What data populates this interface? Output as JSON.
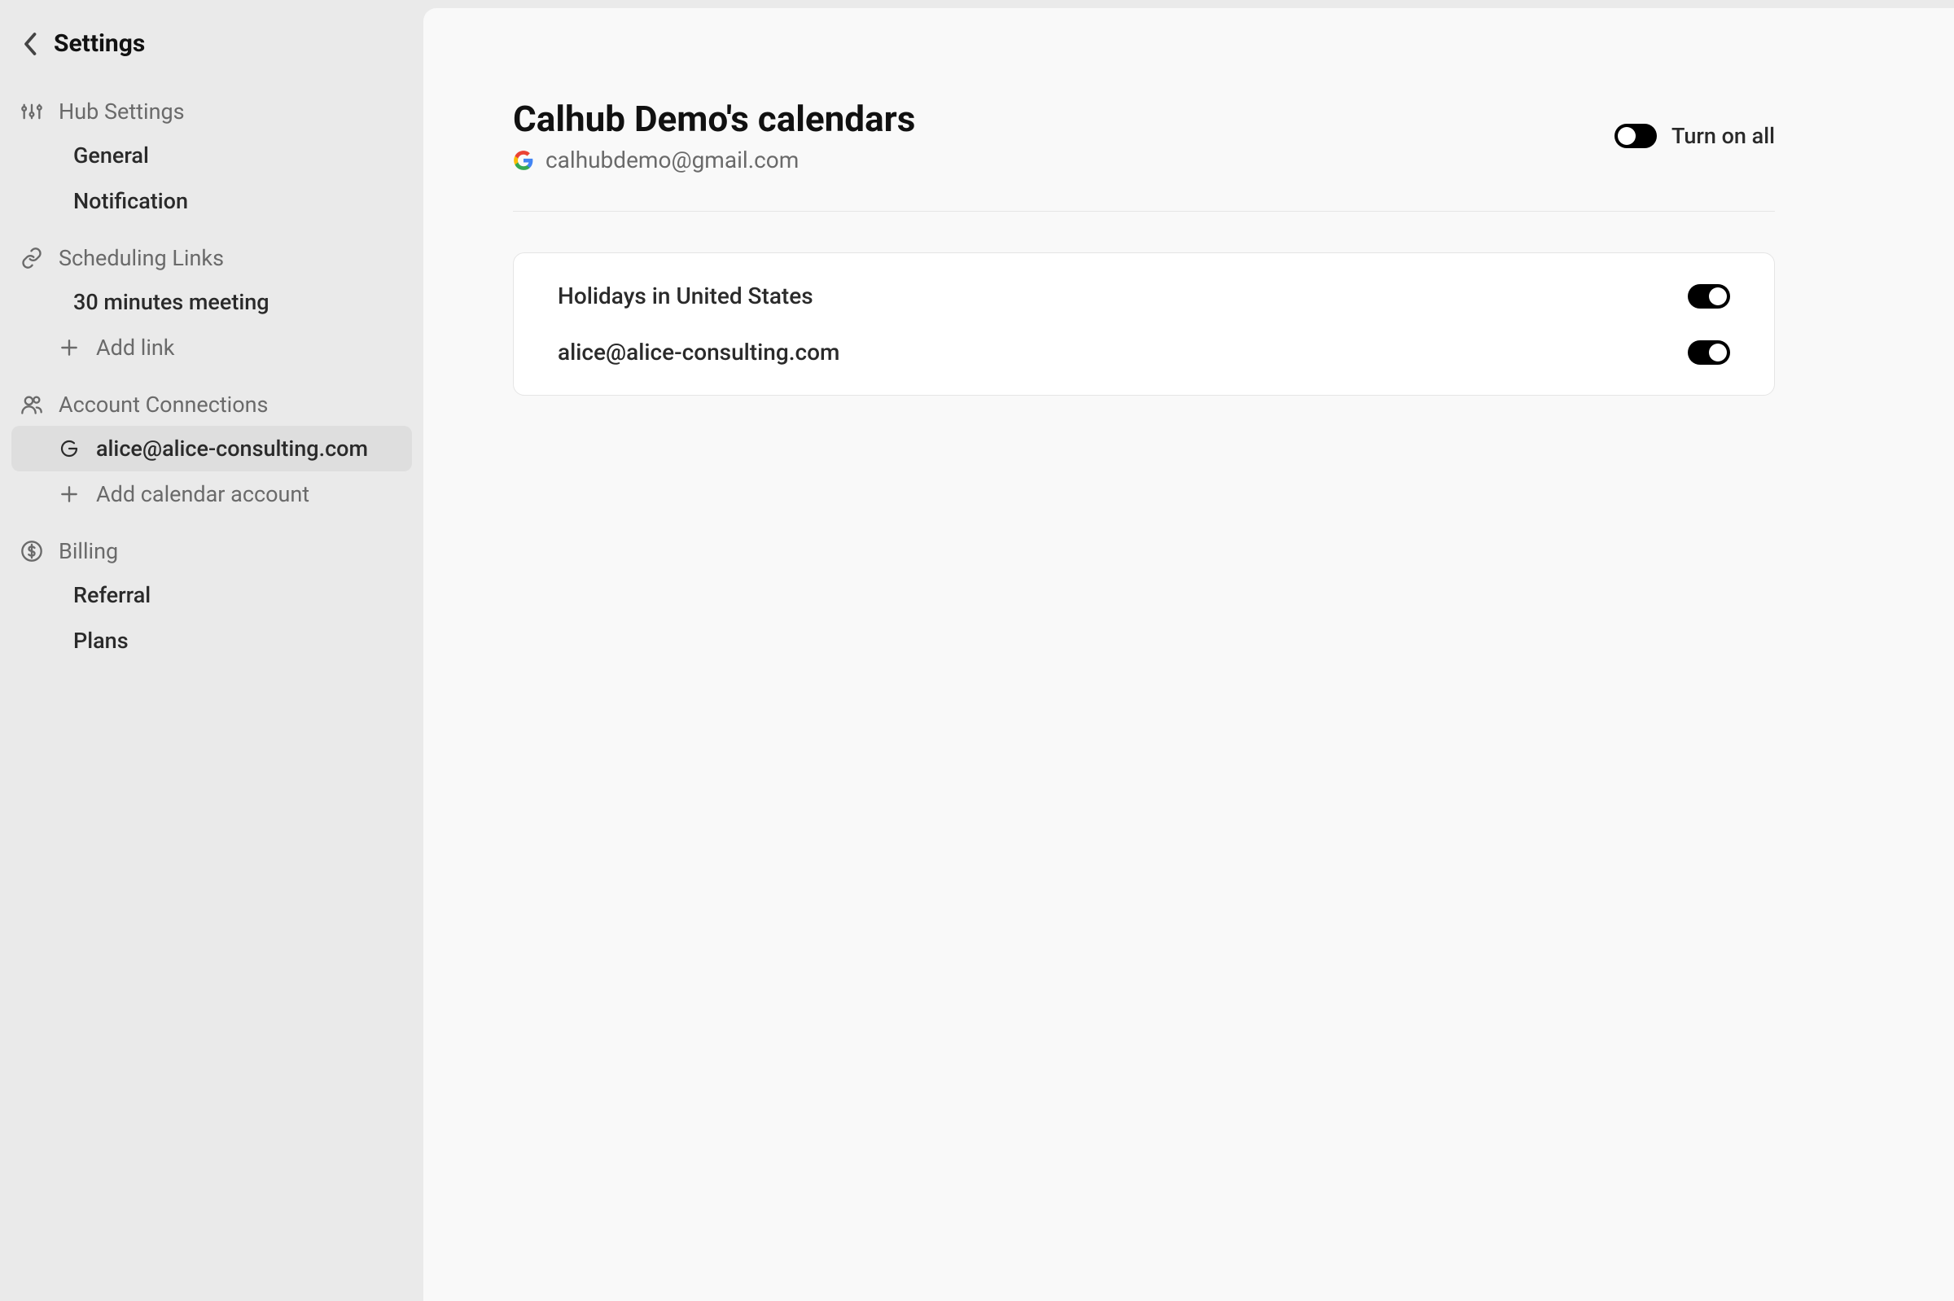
{
  "sidebar": {
    "title": "Settings",
    "sections": {
      "hub": {
        "label": "Hub Settings",
        "items": [
          {
            "label": "General"
          },
          {
            "label": "Notification"
          }
        ]
      },
      "scheduling": {
        "label": "Scheduling Links",
        "items": [
          {
            "label": "30 minutes meeting"
          },
          {
            "label": "Add link"
          }
        ]
      },
      "accounts": {
        "label": "Account Connections",
        "items": [
          {
            "label": "alice@alice-consulting.com"
          },
          {
            "label": "Add calendar account"
          }
        ]
      },
      "billing": {
        "label": "Billing",
        "items": [
          {
            "label": "Referral"
          },
          {
            "label": "Plans"
          }
        ]
      }
    }
  },
  "main": {
    "title": "Calhub Demo's calendars",
    "email": "calhubdemo@gmail.com",
    "turn_on_all_label": "Turn on all",
    "turn_on_all_state": "off",
    "calendars": [
      {
        "label": "Holidays in United States",
        "on": true
      },
      {
        "label": "alice@alice-consulting.com",
        "on": true
      }
    ]
  }
}
